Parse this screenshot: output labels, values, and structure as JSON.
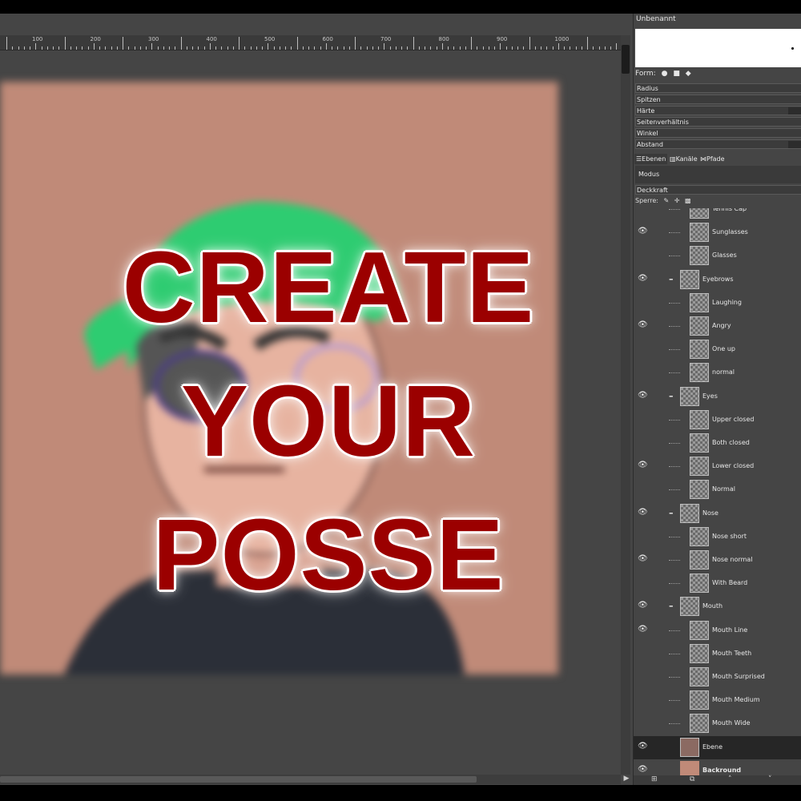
{
  "canvas": {
    "ruler_labels": [
      "100",
      "200",
      "300",
      "400",
      "500",
      "600",
      "700",
      "800",
      "900",
      "1000"
    ],
    "overlay_lines": [
      "CREATE",
      "YOUR",
      "POSSE"
    ]
  },
  "dock": {
    "brush_name": "Unbenannt",
    "form_label": "Form:",
    "options": [
      "Radius",
      "Spitzen",
      "Härte",
      "Seitenverhältnis",
      "Winkel",
      "Abstand"
    ],
    "tabs": [
      "Ebenen",
      "Kanäle",
      "Pfade"
    ],
    "mode_label": "Modus",
    "opacity_label": "Deckkraft",
    "lock_label": "Sperre:"
  },
  "layers": [
    {
      "name": "Tennis Cap",
      "visible": false,
      "level": 2
    },
    {
      "name": "Sunglasses",
      "visible": true,
      "level": 2
    },
    {
      "name": "Glasses",
      "visible": false,
      "level": 2
    },
    {
      "name": "Eyebrows",
      "visible": true,
      "level": 1,
      "group": true
    },
    {
      "name": "Laughing",
      "visible": false,
      "level": 2
    },
    {
      "name": "Angry",
      "visible": true,
      "level": 2
    },
    {
      "name": "One up",
      "visible": false,
      "level": 2
    },
    {
      "name": "normal",
      "visible": false,
      "level": 2
    },
    {
      "name": "Eyes",
      "visible": true,
      "level": 1,
      "group": true
    },
    {
      "name": "Upper closed",
      "visible": false,
      "level": 2
    },
    {
      "name": "Both closed",
      "visible": false,
      "level": 2
    },
    {
      "name": "Lower closed",
      "visible": true,
      "level": 2
    },
    {
      "name": "Normal",
      "visible": false,
      "level": 2
    },
    {
      "name": "Nose",
      "visible": true,
      "level": 1,
      "group": true
    },
    {
      "name": "Nose short",
      "visible": false,
      "level": 2
    },
    {
      "name": "Nose normal",
      "visible": true,
      "level": 2
    },
    {
      "name": "With Beard",
      "visible": false,
      "level": 2
    },
    {
      "name": "Mouth",
      "visible": true,
      "level": 1,
      "group": true
    },
    {
      "name": "Mouth Line",
      "visible": true,
      "level": 2
    },
    {
      "name": "Mouth Teeth",
      "visible": false,
      "level": 2
    },
    {
      "name": "Mouth Surprised",
      "visible": false,
      "level": 2
    },
    {
      "name": "Mouth Medium",
      "visible": false,
      "level": 2
    },
    {
      "name": "Mouth Wide",
      "visible": false,
      "level": 2
    },
    {
      "name": "Ebene",
      "visible": true,
      "level": 0,
      "selected": true,
      "thumb": "photo"
    },
    {
      "name": "Backround",
      "visible": true,
      "level": 0,
      "thumb": "tan",
      "bold": true
    }
  ],
  "colors": {
    "overlay_text": "#9b0000",
    "image_bg": "#c08a78",
    "cap": "#2ecc71",
    "shirt": "#2b2f38"
  }
}
